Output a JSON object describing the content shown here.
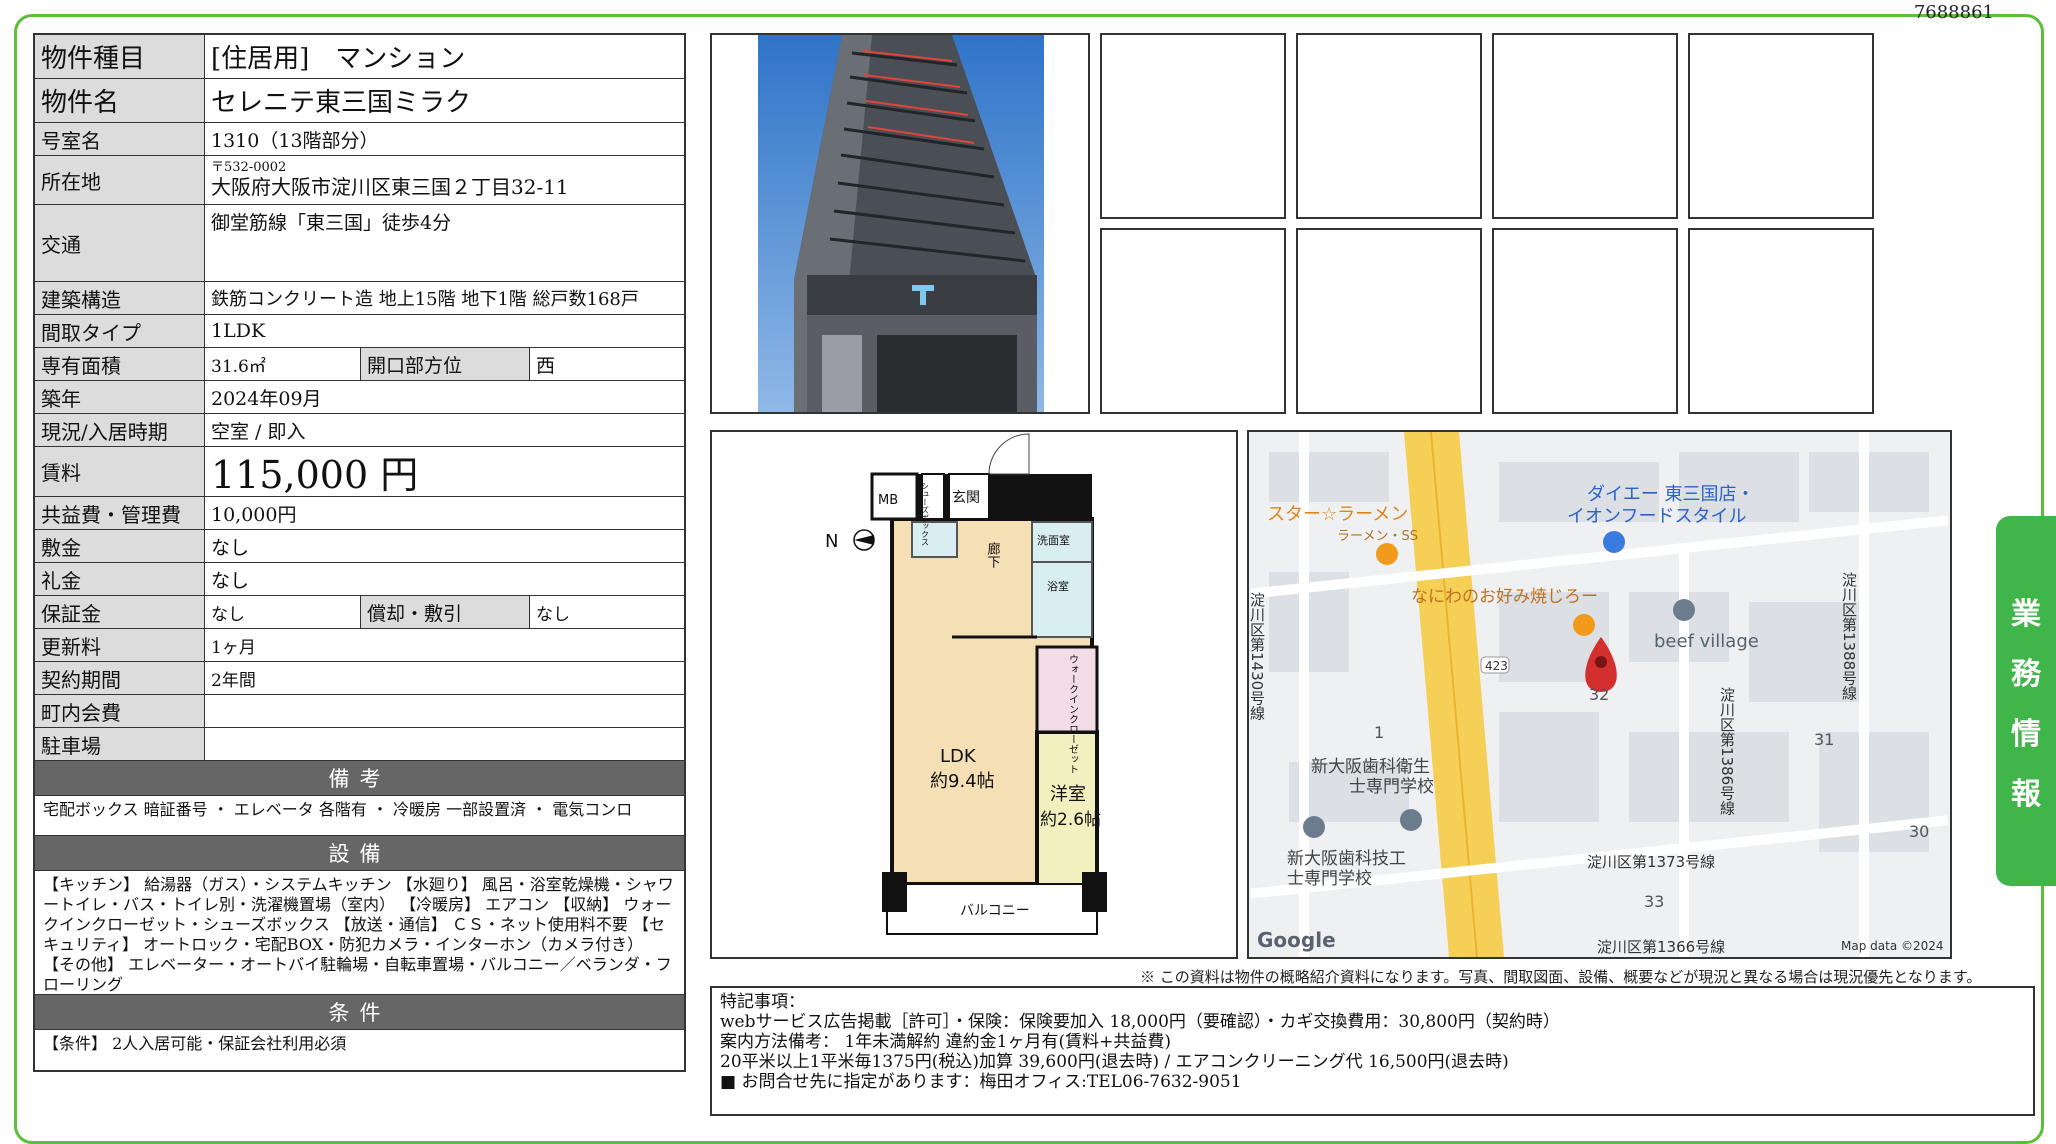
{
  "doc_id": "7688861",
  "property": {
    "type_label": "物件種目",
    "type_value": "[住居用]　マンション",
    "name_label": "物件名",
    "name_value": "セレニテ東三国ミラク",
    "room_label": "号室名",
    "room_value": "1310（13階部分）",
    "address_label": "所在地",
    "postal": "〒532-0002",
    "address": "大阪府大阪市淀川区東三国２丁目32-11",
    "transport_label": "交通",
    "transport_value": "御堂筋線「東三国」徒歩4分",
    "structure_label": "建築構造",
    "structure_value": "鉄筋コンクリート造 地上15階 地下1階 総戸数168戸",
    "layout_label": "間取タイプ",
    "layout_value": "1LDK",
    "area_label": "専有面積",
    "area_value": "31.6㎡",
    "direction_label": "開口部方位",
    "direction_value": "西",
    "built_label": "築年",
    "built_value": "2024年09月",
    "status_label": "現況/入居時期",
    "status_value": "空室 / 即入",
    "rent_label": "賃料",
    "rent_value": "115,000 円",
    "fee_label": "共益費・管理費",
    "fee_value": "10,000円",
    "deposit_label": "敷金",
    "deposit_value": "なし",
    "key_money_label": "礼金",
    "key_money_value": "なし",
    "guarantee_label": "保証金",
    "guarantee_value": "なし",
    "amort_label": "償却・敷引",
    "amort_value": "なし",
    "renewal_label": "更新料",
    "renewal_value": "1ヶ月",
    "contract_label": "契約期間",
    "contract_value": "2年間",
    "assoc_label": "町内会費",
    "assoc_value": "",
    "parking_label": "駐車場",
    "parking_value": ""
  },
  "sections": {
    "remarks_head": "備考",
    "remarks_text": "宅配ボックス 暗証番号 ・ エレベータ 各階有 ・ 冷暖房 一部設置済 ・ 電気コンロ",
    "facilities_head": "設備",
    "facilities_text": "【キッチン】 給湯器（ガス）・システムキッチン 【水廻り】 風呂・浴室乾燥機・シャワートイレ・バス・トイレ別・洗濯機置場（室内） 【冷暖房】 エアコン 【収納】 ウォークインクローゼット・シューズボックス 【放送・通信】 ＣＳ・ネット使用料不要 【セキュリティ】 オートロック・宅配BOX・防犯カメラ・インターホン（カメラ付き） 【その他】 エレベーター・オートバイ駐輪場・自転車置場・バルコニー／ベランダ・フローリング",
    "conditions_head": "条件",
    "conditions_text": "【条件】 2人入居可能・保証会社利用必須"
  },
  "floorplan": {
    "mb": "MB",
    "shoes": "シューズボックス",
    "entrance": "玄関",
    "hall": "廊下",
    "washroom": "洗面室",
    "bath": "浴室",
    "wic": "ウォークインクローゼット",
    "ldk": "LDK",
    "ldk_size": "約9.4帖",
    "western": "洋室",
    "western_size": "約2.6帖",
    "balcony": "バルコニー",
    "north": "N"
  },
  "map": {
    "labels": [
      "スター☆ラーメン",
      "ラーメン・SS",
      "ダイエー 東三国店・",
      "イオンフードスタイル",
      "なにわのお好み焼じろー",
      "beef village",
      "淀川区第1430号線",
      "淀川区第1388号線",
      "淀川区第1386号線",
      "淀川区第1373号線",
      "淀川区第1366号線",
      "新大阪歯科衛生",
      "士専門学校",
      "新大阪歯科技工",
      "士専門学校",
      "423",
      "32",
      "31",
      "30",
      "33",
      "1"
    ],
    "google": "Google",
    "attribution": "Map data ©2024"
  },
  "note": "※ この資料は物件の概略紹介資料になります。写真、間取図面、設備、概要などが現況と異なる場合は現況優先となります。",
  "special": {
    "title": "特記事項：",
    "line1": "webサービス広告掲載［許可］・保険：保険要加入 18,000円（要確認）・カギ交換費用：30,800円（契約時）",
    "line2": "案内方法備考： 1年未満解約 違約金1ヶ月有(賃料+共益費)",
    "line3": "20平米以上1平米毎1375円(税込)加算 39,600円(退去時) / エアコンクリーニング代 16,500円(退去時)",
    "line4": "■ お問合せ先に指定があります：梅田オフィス:TEL06-7632-9051"
  },
  "side_tab": [
    "業",
    "務",
    "情",
    "報"
  ],
  "colors": {
    "frame": "#5cbf3a",
    "tab": "#3fb54a",
    "label_bg": "#dcdcdc",
    "section_bg": "#666666",
    "pin": "#d32f2f"
  }
}
